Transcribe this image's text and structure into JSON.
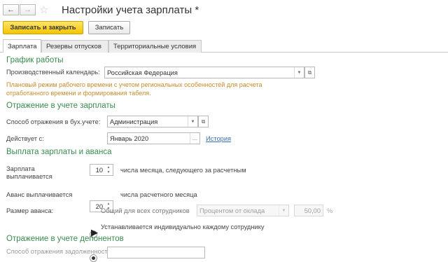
{
  "header": {
    "title": "Настройки учета зарплаты *",
    "back_icon": "arrow-left",
    "forward_icon": "arrow-right",
    "favorite_icon": "star"
  },
  "toolbar": {
    "save_close_label": "Записать и закрыть",
    "save_label": "Записать"
  },
  "tabs": [
    {
      "label": "Зарплата"
    },
    {
      "label": "Резервы отпусков"
    },
    {
      "label": "Территориальные условия"
    }
  ],
  "schedule": {
    "section_title": "График работы",
    "calendar_label": "Производственный календарь:",
    "calendar_value": "Российская Федерация",
    "hint_line1": "Плановый режим рабочего времени с учетом региональных особенностей для расчета",
    "hint_line2": "отработанного времени и формирования табеля."
  },
  "reflection": {
    "section_title": "Отражение в учете зарплаты",
    "method_label": "Способ отражения в бух.учете:",
    "method_value": "Администрация",
    "effective_label": "Действует с:",
    "effective_value": "Январь 2020",
    "history_link": "История"
  },
  "payment": {
    "section_title": "Выплата зарплаты и аванса",
    "salary_label_line1": "Зарплата",
    "salary_label_line2": "выплачивается",
    "salary_day": "10",
    "salary_suffix": "числа месяца, следующего за расчетным",
    "advance_label": "Аванс выплачивается",
    "advance_day": "20",
    "advance_suffix": "числа расчетного месяца",
    "advance_size_label": "Размер аванса:",
    "option_common": "Общий для всех сотрудников",
    "percent_mode": "Процентом от оклада",
    "percent_value": "50,00",
    "percent_sign": "%",
    "option_individual": "Устанавливается индивидуально каждому сотруднику",
    "selected_option": "individual"
  },
  "deponents": {
    "section_title": "Отражение в учете депонентов",
    "partial_label": "Способ отражения задолженности перед"
  }
}
